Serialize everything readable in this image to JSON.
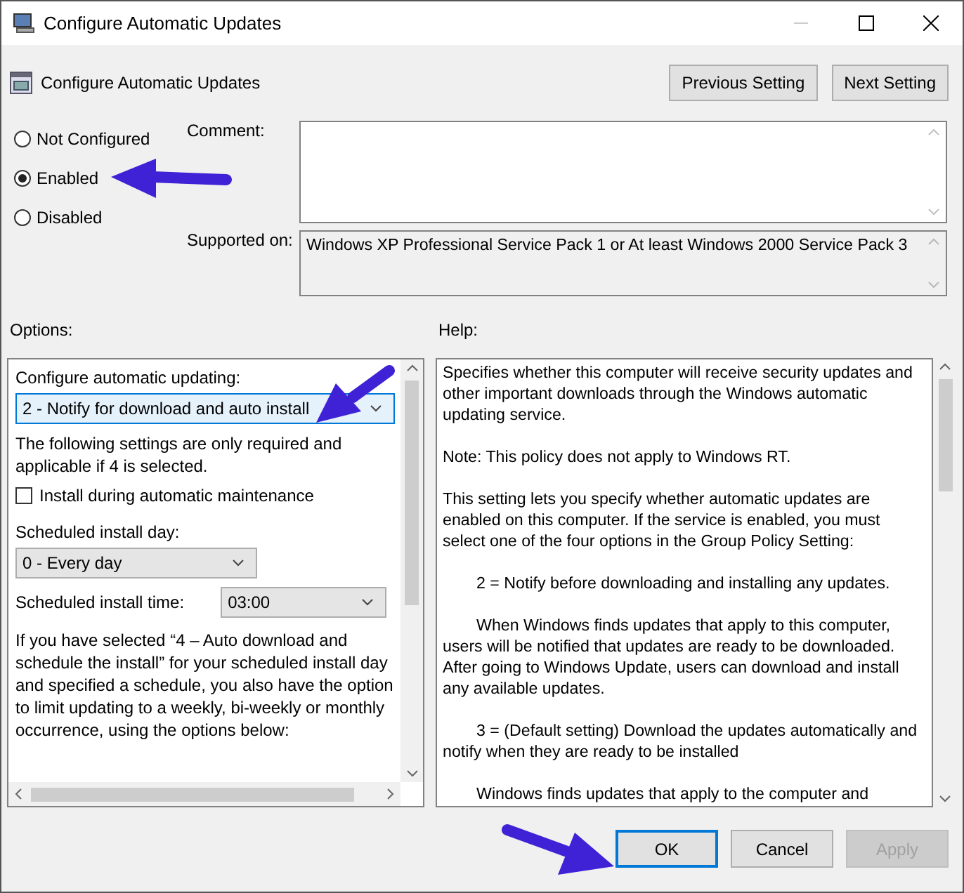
{
  "window": {
    "title": "Configure Automatic Updates"
  },
  "header": {
    "title": "Configure Automatic Updates",
    "buttons": [
      {
        "label": "Previous Setting"
      },
      {
        "label": "Next Setting"
      }
    ]
  },
  "state_options": [
    {
      "label": "Not Configured",
      "selected": false
    },
    {
      "label": "Enabled",
      "selected": true
    },
    {
      "label": "Disabled",
      "selected": false
    }
  ],
  "comment": {
    "label": "Comment:"
  },
  "supported_on": {
    "label": "Supported on:",
    "value": "Windows XP Professional Service Pack 1 or At least Windows 2000 Service Pack 3"
  },
  "options": {
    "label": "Options:",
    "items": [
      {
        "kind": "label",
        "text": "Configure automatic updating:"
      },
      {
        "kind": "dropdown",
        "value": "2 - Notify for download and auto install",
        "focused": true
      },
      {
        "kind": "text",
        "text": "The following settings are only required and applicable if 4 is selected."
      },
      {
        "kind": "checkbox",
        "label": "Install during automatic maintenance",
        "checked": false
      },
      {
        "kind": "label",
        "text": "Scheduled install day:"
      },
      {
        "kind": "dropdown",
        "value": "0 - Every day",
        "focused": false
      },
      {
        "kind": "labeled-dropdown",
        "label": "Scheduled install time:",
        "value": "03:00",
        "focused": false
      },
      {
        "kind": "text",
        "text": "If you have selected “4 – Auto download and schedule the install” for your scheduled install day and specified a schedule, you also have the option to limit updating to a weekly, bi-weekly or monthly occurrence, using the options below:"
      }
    ]
  },
  "help": {
    "label": "Help:",
    "paragraphs": [
      {
        "kind": "plain",
        "text": "Specifies whether this computer will receive security updates and other important downloads through the Windows automatic updating service."
      },
      {
        "kind": "plain",
        "text": "Note: This policy does not apply to Windows RT."
      },
      {
        "kind": "plain",
        "text": "This setting lets you specify whether automatic updates are enabled on this computer. If the service is enabled, you must select one of the four options in the Group Policy Setting:"
      },
      {
        "kind": "indented",
        "text": "2 = Notify before downloading and installing any updates."
      },
      {
        "kind": "indented",
        "text": "When Windows finds updates that apply to this computer, users will be notified that updates are ready to be downloaded. After going to Windows Update, users can download and install any available updates."
      },
      {
        "kind": "indented",
        "text": "3 = (Default setting) Download the updates automatically and notify when they are ready to be installed"
      },
      {
        "kind": "indented",
        "text": "Windows finds updates that apply to the computer and"
      }
    ]
  },
  "buttons": [
    {
      "label": "OK",
      "default": true,
      "disabled": false
    },
    {
      "label": "Cancel",
      "default": false,
      "disabled": false
    },
    {
      "label": "Apply",
      "default": false,
      "disabled": true
    }
  ]
}
